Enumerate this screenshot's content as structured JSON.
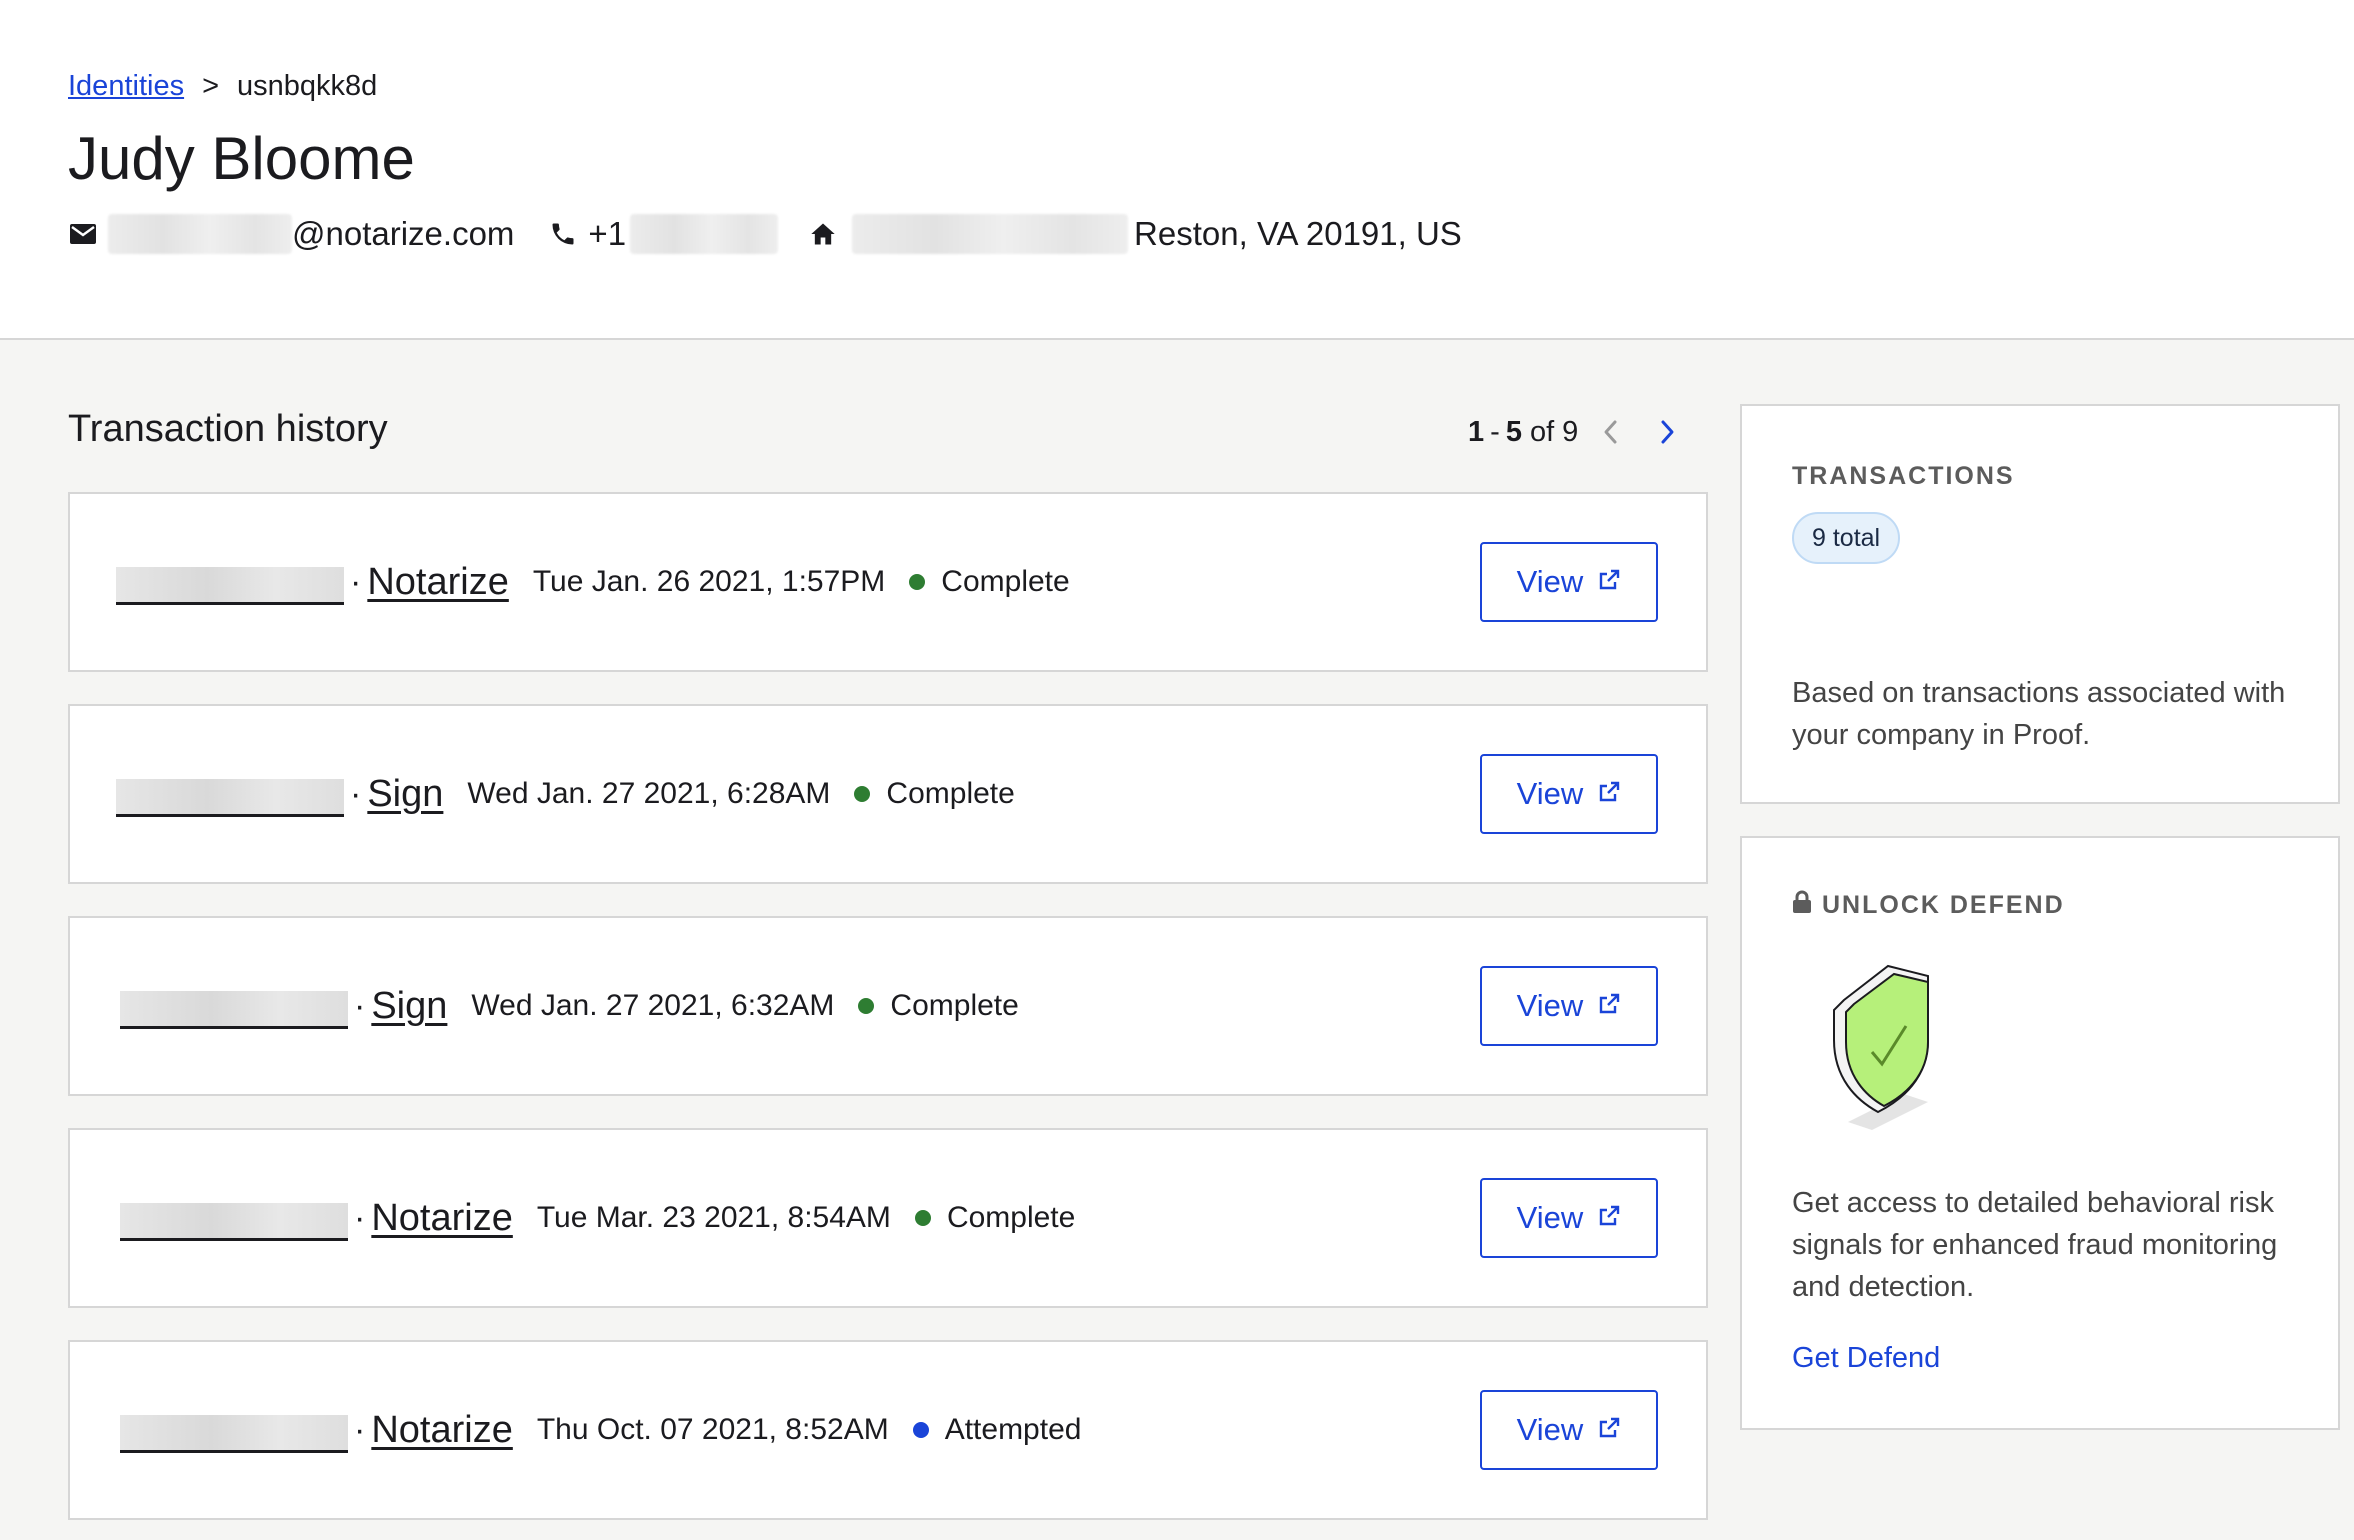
{
  "breadcrumb": {
    "parent": "Identities",
    "separator": ">",
    "current": "usnbqkk8d"
  },
  "identity": {
    "name": "Judy Bloome",
    "email_suffix": "@notarize.com",
    "phone_prefix": "+1",
    "address_suffix": "Reston, VA 20191, US"
  },
  "icons": {
    "email": "envelope-icon",
    "phone": "phone-icon",
    "address": "home-icon",
    "lock": "lock-icon",
    "external": "external-link-icon",
    "shield": "shield-check-illustration"
  },
  "history": {
    "title": "Transaction history",
    "pager": {
      "start": "1",
      "dash": "-",
      "end": "5",
      "of_label": "of",
      "total": "9"
    },
    "view_label": "View",
    "transactions": [
      {
        "type": "Notarize",
        "date": "Tue Jan. 26 2021, 1:57PM",
        "status": "Complete",
        "status_color": "#2e7d32"
      },
      {
        "type": "Sign",
        "date": "Wed Jan. 27 2021, 6:28AM",
        "status": "Complete",
        "status_color": "#2e7d32"
      },
      {
        "type": "Sign",
        "date": "Wed Jan. 27 2021, 6:32AM",
        "status": "Complete",
        "status_color": "#2e7d32"
      },
      {
        "type": "Notarize",
        "date": "Tue Mar. 23 2021, 8:54AM",
        "status": "Complete",
        "status_color": "#2e7d32"
      },
      {
        "type": "Notarize",
        "date": "Thu Oct. 07 2021, 8:52AM",
        "status": "Attempted",
        "status_color": "#1a44d8"
      }
    ]
  },
  "transactions_card": {
    "title": "TRANSACTIONS",
    "badge": "9 total",
    "description": "Based on transactions associated with your company in Proof."
  },
  "defend_card": {
    "title": "UNLOCK DEFEND",
    "description": "Get access to detailed behavioral risk signals for enhanced fraud monitoring and detection.",
    "link": "Get Defend"
  },
  "colors": {
    "accent": "#1a44d8",
    "complete": "#2e7d32",
    "shield_fill": "#b6f07a"
  }
}
